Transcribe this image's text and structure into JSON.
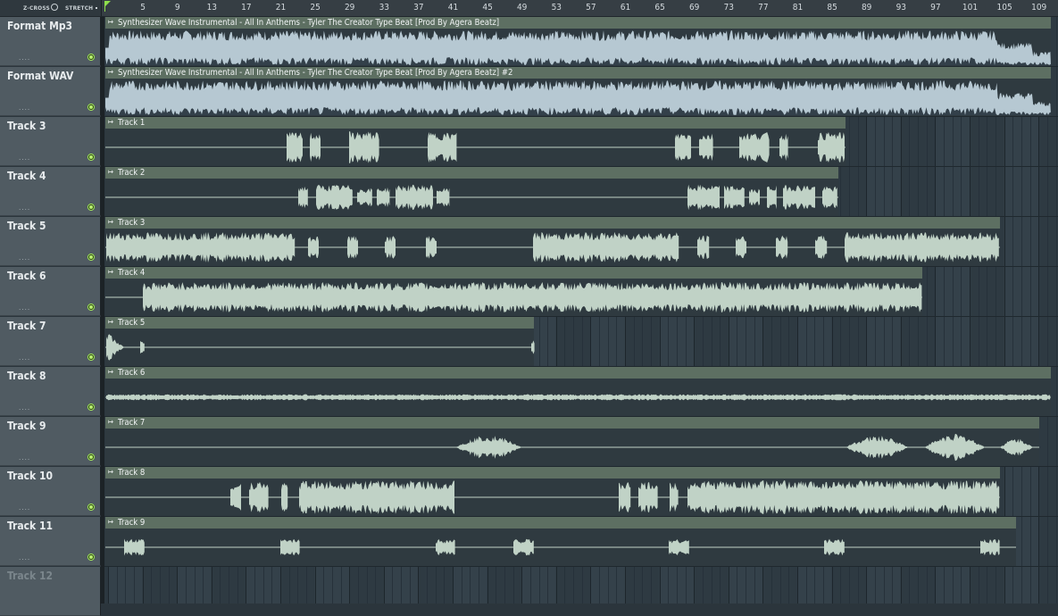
{
  "toolbar": {
    "zcross_label": "Z-CROSS",
    "stretch_label": "STRETCH"
  },
  "ruler": {
    "bars": [
      "5",
      "9",
      "13",
      "17",
      "21",
      "25",
      "29",
      "33",
      "37",
      "41",
      "45",
      "49",
      "53",
      "57",
      "61",
      "65",
      "69",
      "73",
      "77",
      "81",
      "85",
      "89",
      "93",
      "97",
      "101",
      "105",
      "109"
    ]
  },
  "colors": {
    "clip_body": "#2f3a40",
    "clip_title_bar": "#5d6f62",
    "wave_fill": "#c0d2c6",
    "wave_fill_audio": "#b6c8d2",
    "wave_body_audio": "#33404a",
    "active_led": "#9fe45a",
    "playhead": "#8fe04c"
  },
  "tracks": [
    {
      "name": "Format Mp3",
      "dots": "....",
      "clip": {
        "title": "Synthesizer Wave Instrumental - All In Anthems - Tyler The Creator Type Beat [Prod By Agera Beatz]",
        "type": "full_audio",
        "end_bar": "end"
      }
    },
    {
      "name": "Format WAV",
      "dots": "....",
      "clip": {
        "title": "Synthesizer Wave Instrumental - All In Anthems - Tyler The Creator Type Beat [Prod By Agera Beatz] #2",
        "type": "full_audio",
        "end_bar": "end"
      }
    },
    {
      "name": "Track 3",
      "dots": "....",
      "clip": {
        "title": "Track 1",
        "type": "bursts"
      }
    },
    {
      "name": "Track 4",
      "dots": "....",
      "clip": {
        "title": "Track 2",
        "type": "bursts"
      }
    },
    {
      "name": "Track 5",
      "dots": "....",
      "clip": {
        "title": "Track 3",
        "type": "dense_bursts"
      }
    },
    {
      "name": "Track 6",
      "dots": "....",
      "clip": {
        "title": "Track 4",
        "type": "continuous"
      }
    },
    {
      "name": "Track 7",
      "dots": "....",
      "clip": {
        "title": "Track 5",
        "type": "one_shot"
      }
    },
    {
      "name": "Track 8",
      "dots": "....",
      "clip": {
        "title": "Track 6",
        "type": "thin_continuous"
      }
    },
    {
      "name": "Track 9",
      "dots": "....",
      "clip": {
        "title": "Track 7",
        "type": "swells"
      }
    },
    {
      "name": "Track 10",
      "dots": "....",
      "clip": {
        "title": "Track 8",
        "type": "blocks"
      }
    },
    {
      "name": "Track 11",
      "dots": "....",
      "clip": {
        "title": "Track 9",
        "type": "hits"
      }
    },
    {
      "name": "Track 12",
      "dots": "",
      "clip": null
    }
  ]
}
